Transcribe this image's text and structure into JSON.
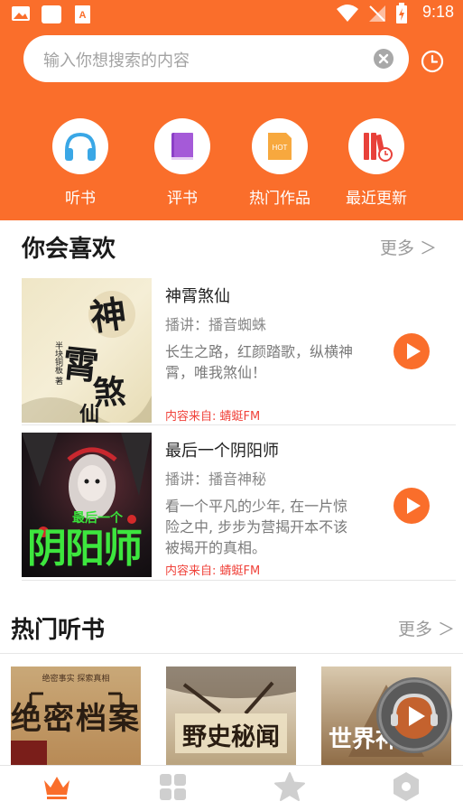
{
  "status_bar": {
    "time": "9:18"
  },
  "search": {
    "placeholder": "输入你想搜索的内容"
  },
  "categories": [
    {
      "label": "听书",
      "icon": "headphones-icon"
    },
    {
      "label": "评书",
      "icon": "book-icon"
    },
    {
      "label": "热门作品",
      "icon": "hot-icon"
    },
    {
      "label": "最近更新",
      "icon": "recent-update-icon"
    }
  ],
  "recommend": {
    "title": "你会喜欢",
    "more": "更多 ＞",
    "items": [
      {
        "title": "神霄煞仙",
        "anchor": "播讲：播音蜘蛛",
        "desc": "长生之路，红颜踏歌，纵横神霄，唯我煞仙！",
        "source": "内容来自: 蜻蜓FM",
        "cover_text": "神霄煞仙",
        "cover_author": "半块铜板 著"
      },
      {
        "title": "最后一个阴阳师",
        "anchor": "播讲：播音神秘",
        "desc": "看一个平凡的少年, 在一片惊险之中, 步步为营揭开本不该被揭开的真相。",
        "source": "内容来自: 蜻蜓FM",
        "cover_small": "最后一个",
        "cover_big": "阴阳师"
      }
    ]
  },
  "hot": {
    "title": "热门听书",
    "more": "更多 ＞",
    "books": [
      {
        "cover_text": "绝密档案",
        "cover_top": "绝密事实  探索真相"
      },
      {
        "cover_text": "野史秘闻"
      },
      {
        "cover_text": "世界神秘"
      }
    ]
  },
  "bottom_nav": [
    {
      "icon": "crown-icon",
      "active": true
    },
    {
      "icon": "grid-icon",
      "active": false
    },
    {
      "icon": "star-icon",
      "active": false
    },
    {
      "icon": "hexagon-icon",
      "active": false
    }
  ],
  "colors": {
    "accent": "#fa6e2b",
    "source_red": "#f0433b"
  }
}
